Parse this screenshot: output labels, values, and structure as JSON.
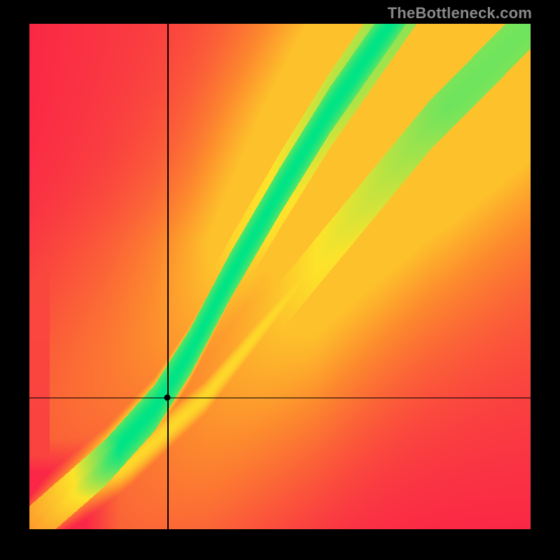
{
  "watermark": "TheBottleneck.com",
  "chart_data": {
    "type": "heatmap",
    "title": "",
    "xlabel": "",
    "ylabel": "",
    "xlim": [
      0,
      1
    ],
    "ylim": [
      0,
      1
    ],
    "crosshair": {
      "x": 0.276,
      "y": 0.26
    },
    "colorscale": {
      "low": "#FA2846",
      "mid_low": "#FD8A2E",
      "mid": "#FEE32A",
      "high": "#00E586"
    },
    "ridge": {
      "comment": "Optimal (green) band centre as y(x); piecewise-linear control points estimated from image.",
      "points": [
        {
          "x": 0.0,
          "y": 0.0
        },
        {
          "x": 0.15,
          "y": 0.13
        },
        {
          "x": 0.25,
          "y": 0.24
        },
        {
          "x": 0.32,
          "y": 0.35
        },
        {
          "x": 0.4,
          "y": 0.5
        },
        {
          "x": 0.5,
          "y": 0.67
        },
        {
          "x": 0.6,
          "y": 0.83
        },
        {
          "x": 0.72,
          "y": 1.0
        }
      ],
      "half_width": 0.045
    },
    "secondary_ridge": {
      "comment": "Fainter yellow band just below/right of main ridge.",
      "points": [
        {
          "x": 0.0,
          "y": 0.0
        },
        {
          "x": 0.2,
          "y": 0.13
        },
        {
          "x": 0.35,
          "y": 0.26
        },
        {
          "x": 0.5,
          "y": 0.44
        },
        {
          "x": 0.65,
          "y": 0.62
        },
        {
          "x": 0.8,
          "y": 0.8
        },
        {
          "x": 1.0,
          "y": 1.0
        }
      ],
      "half_width": 0.035
    }
  }
}
